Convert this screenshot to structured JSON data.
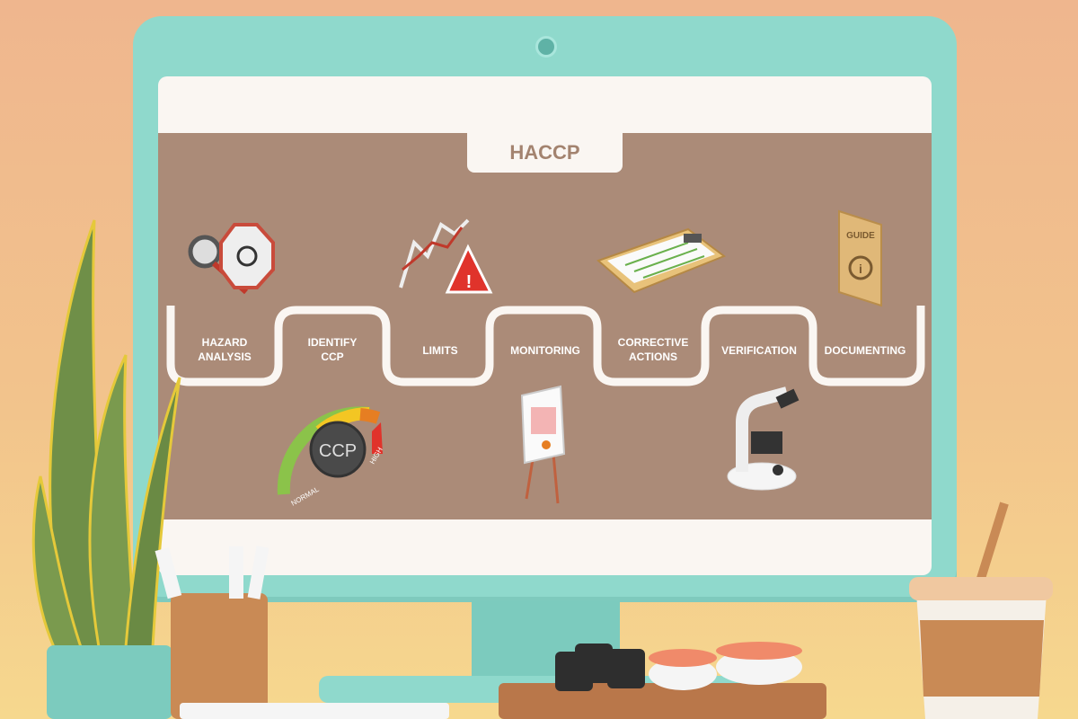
{
  "diagram": {
    "title": "HACCP",
    "steps": [
      {
        "label_line1": "HAZARD",
        "label_line2": "ANALYSIS",
        "icon": "magnifier-biohazard-icon"
      },
      {
        "label_line1": "IDENTIFY",
        "label_line2": "CCP",
        "icon": "ccp-gauge-icon"
      },
      {
        "label_line1": "LIMITS",
        "label_line2": "",
        "icon": "chart-warning-icon"
      },
      {
        "label_line1": "MONITORING",
        "label_line2": "",
        "icon": "easel-chart-icon"
      },
      {
        "label_line1": "CORRECTIVE",
        "label_line2": "ACTIONS",
        "icon": "clipboard-checklist-icon"
      },
      {
        "label_line1": "VERIFICATION",
        "label_line2": "",
        "icon": "microscope-icon"
      },
      {
        "label_line1": "DOCUMENTING",
        "label_line2": "",
        "icon": "guide-book-icon"
      }
    ],
    "gauge": {
      "text": "CCP",
      "low_label": "NORMAL",
      "high_label": "HIGH"
    },
    "book_text": "GUIDE"
  },
  "colors": {
    "panel": "#ab8b78",
    "bezel": "#8fd9cc",
    "title": "#a3836f"
  }
}
